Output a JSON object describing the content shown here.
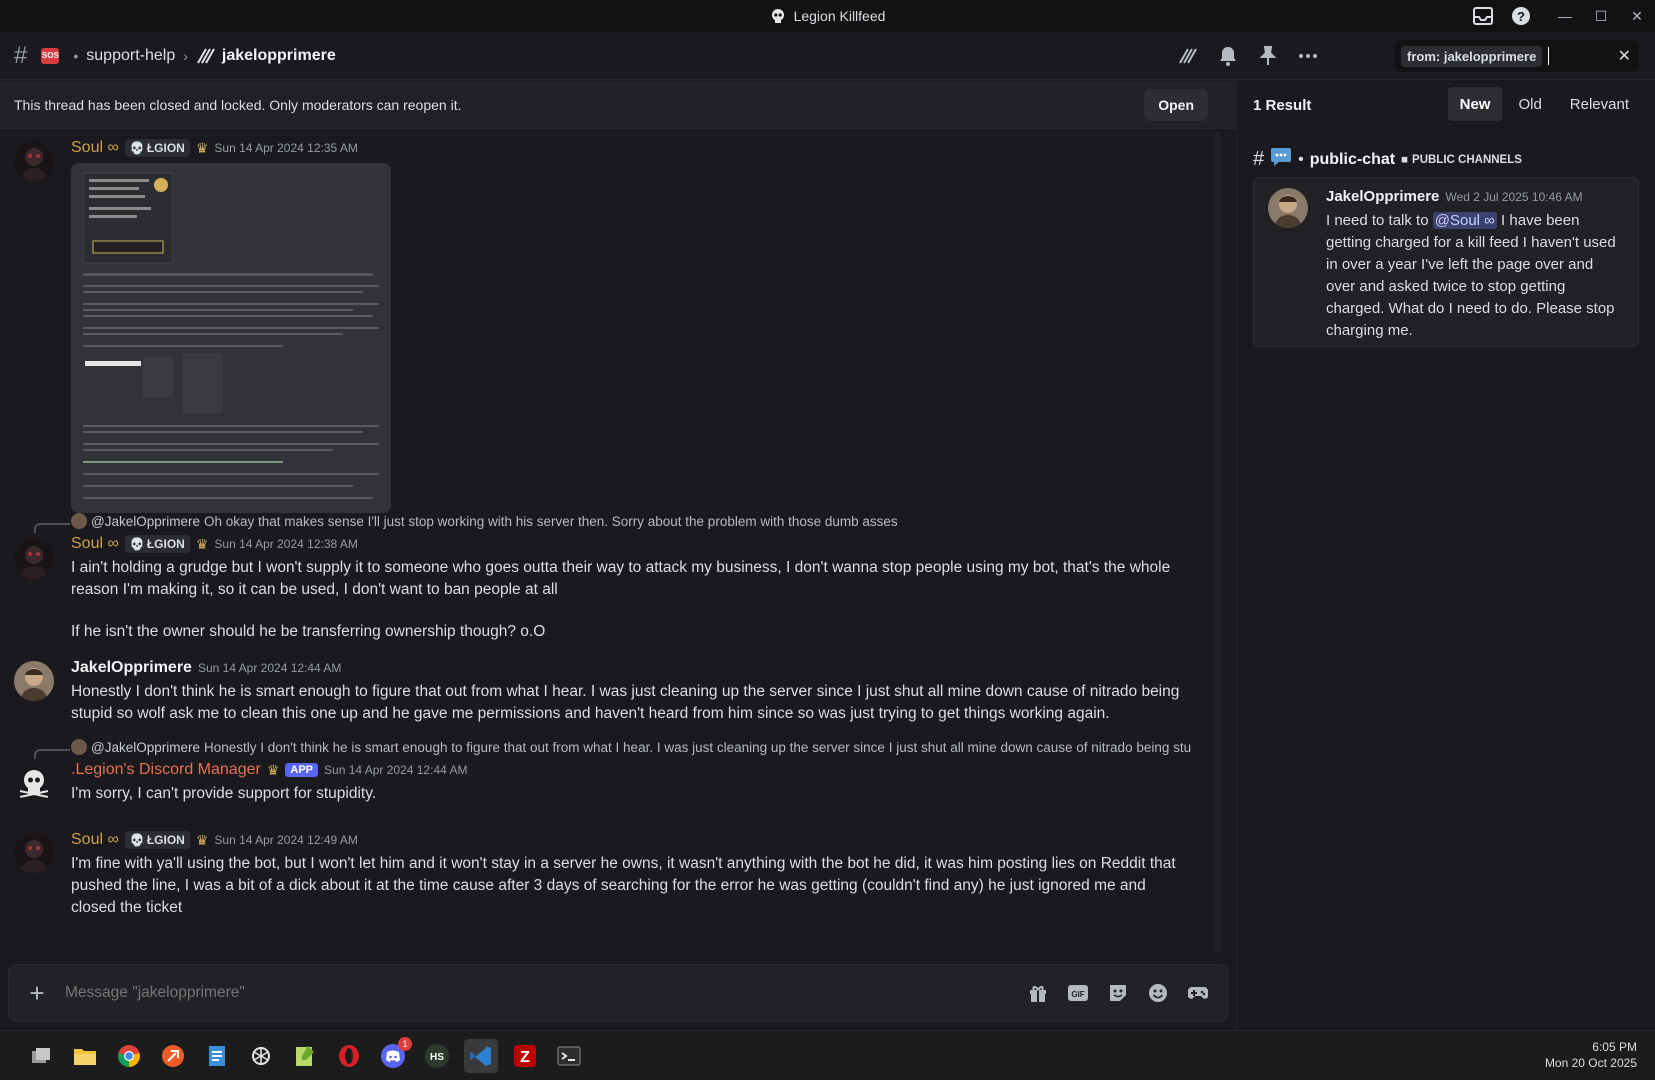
{
  "window": {
    "title": "Legion Killfeed"
  },
  "header": {
    "server_badge": "SOS",
    "channel": "support-help",
    "thread": "jakelopprimere",
    "search_chip": "from: jakelopprimere"
  },
  "lockbar": {
    "text": "This thread has been closed and locked. Only moderators can reopen it.",
    "open_label": "Open"
  },
  "messages": [
    {
      "user": "Soul",
      "suffix": "∞",
      "tag": "ŁGION",
      "ts": "Sun 14 Apr 2024 12:35 AM"
    },
    {
      "reply_to": "@JakelOpprimere",
      "reply_text": "Oh okay that makes sense I'll just stop working with his server then. Sorry about the problem with those dumb asses",
      "user": "Soul",
      "suffix": "∞",
      "tag": "ŁGION",
      "ts": "Sun 14 Apr 2024 12:38 AM",
      "text1": "I ain't holding a grudge but I won't supply it to someone who goes outta their way to attack my business, I don't wanna stop people using my bot, that's the whole reason I'm making it, so it can be used, I don't want to ban people at all",
      "text2": "If he isn't the owner should he be transferring ownership though? o.O"
    },
    {
      "user": "JakelOpprimere",
      "ts": "Sun 14 Apr 2024 12:44 AM",
      "text": "Honestly I don't think he is smart enough to figure that out from what I hear. I was just cleaning up the server since I just shut all mine down cause of nitrado being stupid so wolf ask me to clean this one up and he gave me permissions and haven't heard from him since so was just trying to get things working again."
    },
    {
      "reply_to": "@JakelOpprimere",
      "reply_text": "Honestly I don't think he is smart enough to figure that out from what I hear. I was just cleaning up the server since I just shut all mine down cause of nitrado being stu...",
      "user_prefix": ".Legion's",
      "user_rest": "Discord Manager",
      "app": "APP",
      "ts": "Sun 14 Apr 2024 12:44 AM",
      "text": "I'm sorry, I can't provide support for stupidity."
    },
    {
      "user": "Soul",
      "suffix": "∞",
      "tag": "ŁGION",
      "ts": "Sun 14 Apr 2024 12:49 AM",
      "text": "I'm fine with ya'll using the bot, but I won't let him and it won't stay in a server he owns, it wasn't anything with the bot he did, it was him posting lies on Reddit that pushed the line, I was a bit of a dick about it at the time cause after 3 days of searching for the error he was getting (couldn't find any) he just ignored me and closed the ticket"
    }
  ],
  "composer": {
    "placeholder": "Message \"jakelopprimere\""
  },
  "side": {
    "results": "1 Result",
    "tabs": [
      "New",
      "Old",
      "Relevant"
    ],
    "channel": "public-chat",
    "category": "PUBLIC CHANNELS",
    "result": {
      "user": "JakelOpprimere",
      "ts": "Wed 2 Jul 2025 10:46 AM",
      "pre": "I need to talk to",
      "mention": "@Soul ∞",
      "post": "I have been getting charged for a kill feed I haven't used in over a year I've left the page over and over and asked twice to stop getting charged. What do I need to do. Please stop charging me."
    }
  },
  "taskbar": {
    "time": "6:05 PM",
    "date": "Mon 20 Oct 2025",
    "discord_badge": "1",
    "hs_label": "HS"
  }
}
